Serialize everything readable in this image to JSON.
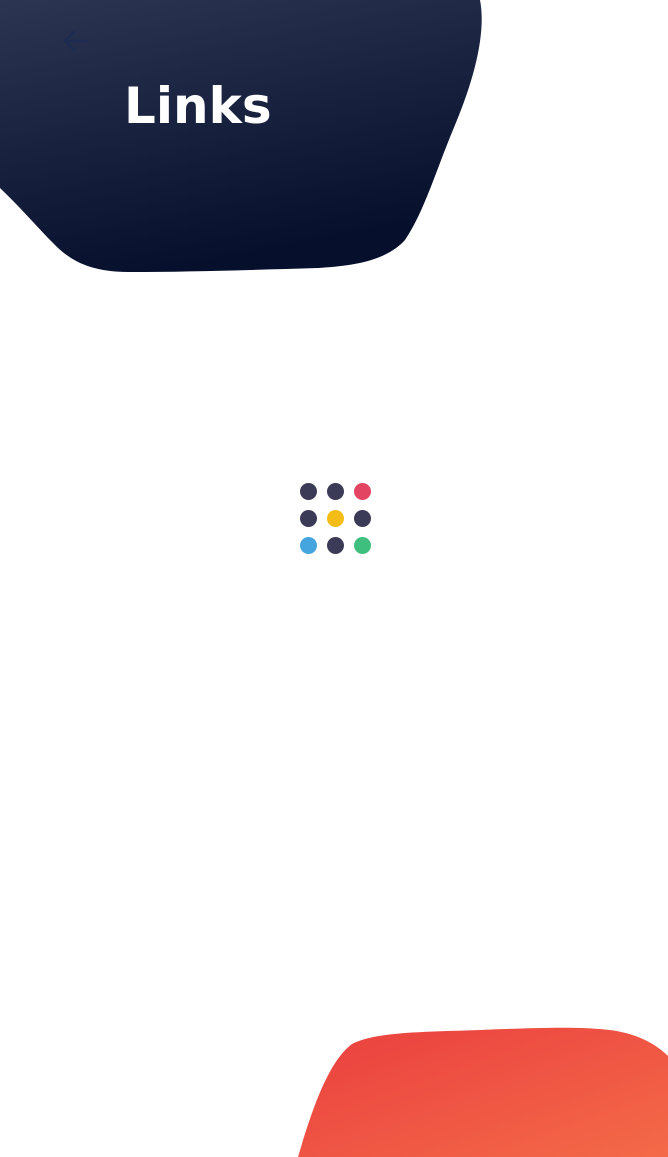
{
  "header": {
    "title": "Links",
    "back_icon": "arrow-left-icon",
    "back_icon_color": "#1d2a52",
    "background_gradient": [
      "#2c3552",
      "#06102c"
    ]
  },
  "loader": {
    "icon": "loading-dots-icon",
    "dots": [
      {
        "color": "#3b3a57"
      },
      {
        "color": "#3b3a57"
      },
      {
        "color": "#e24462"
      },
      {
        "color": "#3b3a57"
      },
      {
        "color": "#f4bc17"
      },
      {
        "color": "#3b3a57"
      },
      {
        "color": "#45a5de"
      },
      {
        "color": "#3b3a57"
      },
      {
        "color": "#3ebf7d"
      }
    ]
  },
  "footer_blob": {
    "background_gradient": [
      "#ea3f3f",
      "#f46a48"
    ]
  }
}
